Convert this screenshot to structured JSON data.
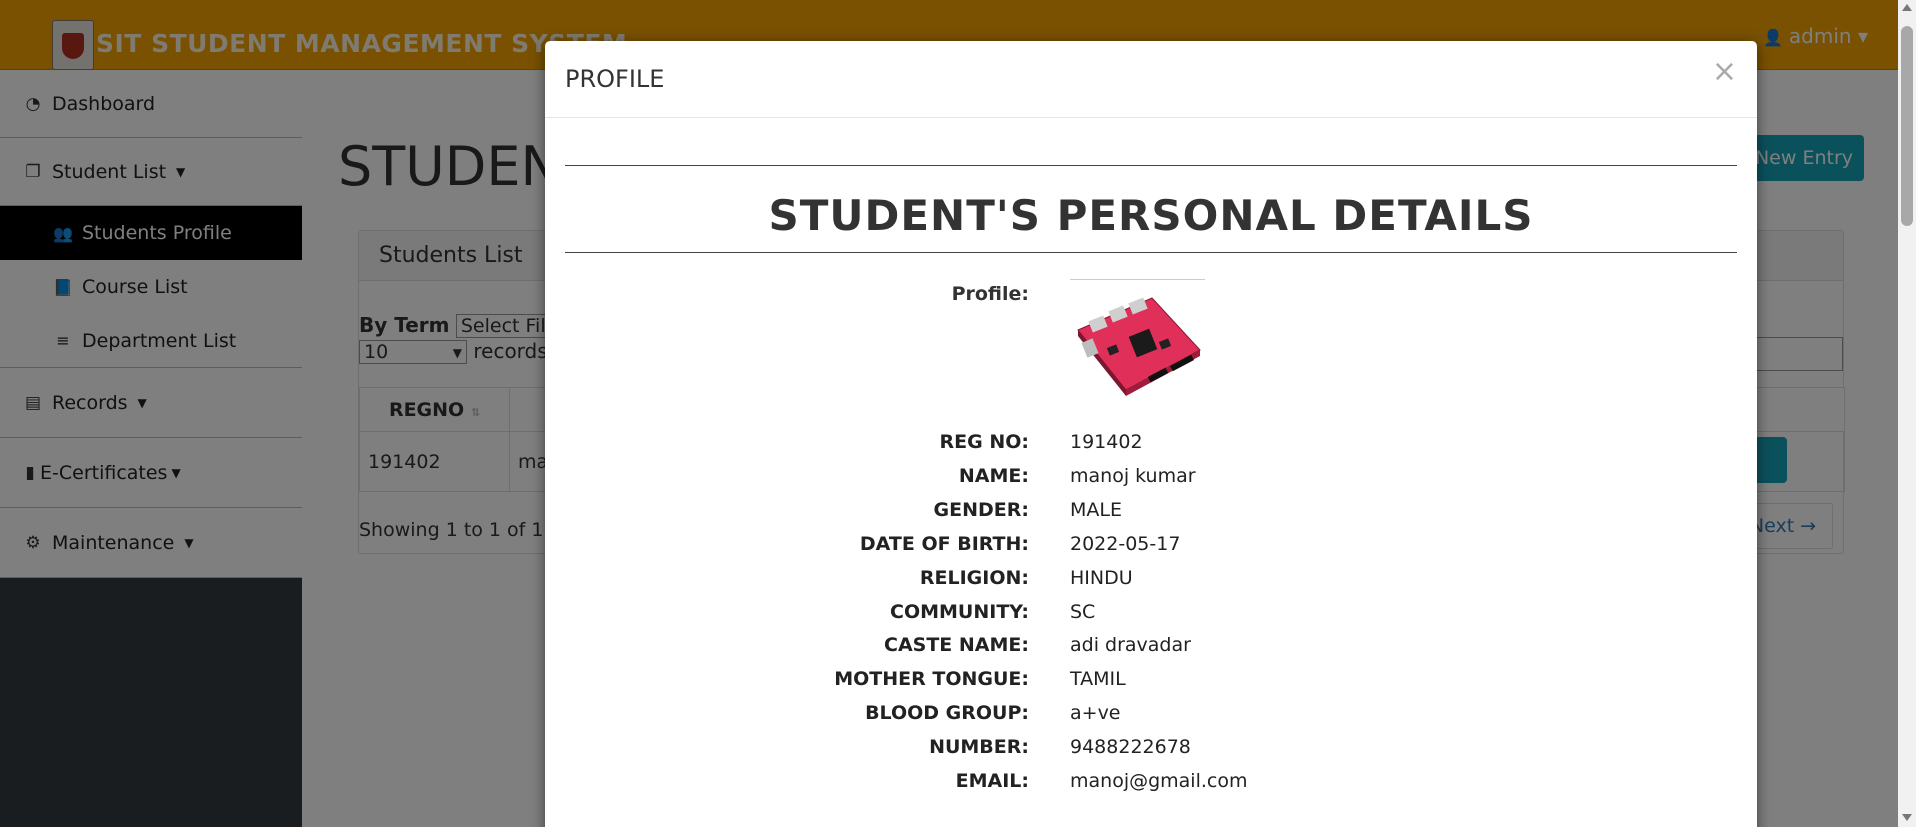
{
  "header": {
    "app_title": "SIT STUDENT MANAGEMENT SYSTEM",
    "user_label": "admin"
  },
  "sidebar": {
    "items": [
      {
        "label": "Dashboard",
        "icon": "dashboard-icon"
      },
      {
        "label": "Student List",
        "icon": "list-icon"
      },
      {
        "label": "Students Profile",
        "icon": "users-icon"
      },
      {
        "label": "Course List",
        "icon": "book-icon"
      },
      {
        "label": "Department List",
        "icon": "bars-icon"
      },
      {
        "label": "Records",
        "icon": "records-icon"
      },
      {
        "label": "E-Certificates",
        "icon": "file-icon"
      },
      {
        "label": "Maintenance",
        "icon": "gears-icon"
      }
    ]
  },
  "main": {
    "page_title": "STUDENT",
    "new_entry_label": "New Entry",
    "card_title": "Students List",
    "filter_label": "By Term",
    "filter_select": "Select Fil",
    "length_value": "10",
    "records_label": "records",
    "table": {
      "headers": [
        "REGNO"
      ],
      "rows": [
        [
          "191402",
          "ma"
        ]
      ]
    },
    "showing_text": "Showing 1 to 1 of 1",
    "next_label": "Next →"
  },
  "modal": {
    "title": "PROFILE",
    "close_glyph": "×",
    "heading": "STUDENT'S PERSONAL DETAILS",
    "profile_label": "Profile:",
    "fields": [
      {
        "label": "REG NO:",
        "value": "191402"
      },
      {
        "label": "NAME:",
        "value": "manoj kumar"
      },
      {
        "label": "GENDER:",
        "value": "MALE"
      },
      {
        "label": "DATE OF BIRTH:",
        "value": "2022-05-17"
      },
      {
        "label": "RELIGION:",
        "value": "HINDU"
      },
      {
        "label": "COMMUNITY:",
        "value": "SC"
      },
      {
        "label": "CASTE NAME:",
        "value": "adi dravadar"
      },
      {
        "label": "MOTHER TONGUE:",
        "value": "TAMIL"
      },
      {
        "label": "BLOOD GROUP:",
        "value": "a+ve"
      },
      {
        "label": "NUMBER:",
        "value": "9488222678"
      },
      {
        "label": "EMAIL:",
        "value": "manoj@gmail.com"
      }
    ]
  },
  "colors": {
    "header_bg": "#f2a200",
    "accent": "#17a2b8",
    "active_nav": "#000000",
    "sidebar_dark": "#343a40"
  }
}
